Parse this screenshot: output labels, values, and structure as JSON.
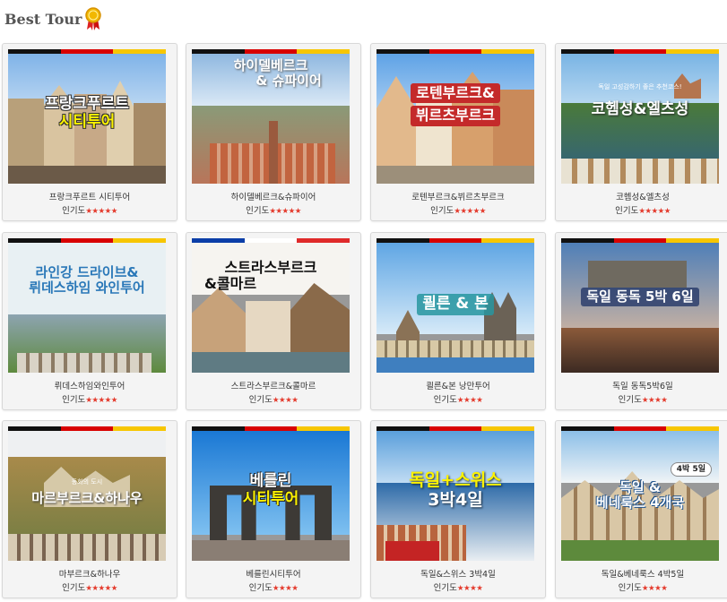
{
  "header": {
    "title": "Best Tour",
    "medal_icon": "medal-icon"
  },
  "rating_label": "인기도",
  "tours": [
    {
      "name": "프랑크푸르트 시티투어",
      "stars": "★★★★★",
      "overlay": [
        "프랑크푸르트",
        "시티투어"
      ],
      "flag": "de"
    },
    {
      "name": "하이델베르크&슈파이어",
      "stars": "★★★★★",
      "overlay": [
        "하이델베르크",
        "& 슈파이어"
      ],
      "flag": "de"
    },
    {
      "name": "로텐부르크&뷔르츠부르크",
      "stars": "★★★★★",
      "overlay": [
        "로텐부르크&",
        "뷔르츠부르크"
      ],
      "flag": "de"
    },
    {
      "name": "코헴성&엘츠성",
      "stars": "★★★★★",
      "overlay": [
        "독일 고성감하기 좋은 추천코스!",
        "코헴성&엘츠성"
      ],
      "flag": "de"
    },
    {
      "name": "뤼데스하임와인투어",
      "stars": "★★★★★",
      "overlay": [
        "라인강 드라이브&",
        "뤼데스하임 와인투어"
      ],
      "flag": "de"
    },
    {
      "name": "스트라스부르크&콜마르",
      "stars": "★★★★",
      "overlay": [
        "스트라스부르크",
        "&콜마르"
      ],
      "flag": "fr"
    },
    {
      "name": "쾰른&본 낭만투어",
      "stars": "★★★★",
      "overlay": [
        "쾰른 & 본"
      ],
      "flag": "de"
    },
    {
      "name": "독일 동독5박6일",
      "stars": "★★★★",
      "overlay": [
        "독일 동독 5박 6일"
      ],
      "flag": "de"
    },
    {
      "name": "마부르크&하나우",
      "stars": "★★★★★",
      "overlay": [
        "동화의 도시",
        "마르부르크&하나우"
      ],
      "flag": "de"
    },
    {
      "name": "베를린시티투어",
      "stars": "★★★★",
      "overlay": [
        "베를린",
        "시티투어"
      ],
      "flag": "de"
    },
    {
      "name": "독일&스위스 3박4일",
      "stars": "★★★★",
      "overlay": [
        "독일+스위스",
        "3박4일"
      ],
      "flag": "de"
    },
    {
      "name": "독일&베네룩스 4박5일",
      "stars": "★★★★",
      "overlay": [
        "4박 5일",
        "독일 &",
        "베네룩스 4개국"
      ],
      "flag": "de"
    }
  ]
}
